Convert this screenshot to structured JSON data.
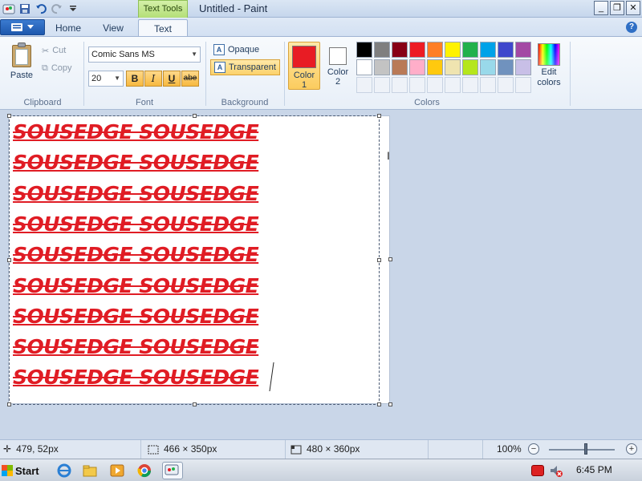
{
  "window": {
    "title": "Untitled - Paint",
    "context_tab": "Text Tools",
    "controls": {
      "minimize": "_",
      "restore": "❐",
      "close": "✕"
    }
  },
  "tabs": [
    {
      "label": "Home"
    },
    {
      "label": "View"
    },
    {
      "label": "Text",
      "active": true
    }
  ],
  "ribbon": {
    "clipboard": {
      "paste": "Paste",
      "cut": "Cut",
      "copy": "Copy",
      "group_label": "Clipboard"
    },
    "font": {
      "family": "Comic Sans MS",
      "size": "20",
      "bold": "B",
      "italic": "I",
      "underline": "U",
      "strikethrough": "abe",
      "group_label": "Font"
    },
    "background": {
      "opaque": "Opaque",
      "transparent": "Transparent",
      "group_label": "Background"
    },
    "colors": {
      "color1_label_a": "Color",
      "color1_label_b": "1",
      "color2_label_a": "Color",
      "color2_label_b": "2",
      "color1": "#e81c24",
      "color2": "#ffffff",
      "edit_a": "Edit",
      "edit_b": "colors",
      "group_label": "Colors",
      "palette_row1": [
        "#000000",
        "#7f7f7f",
        "#880015",
        "#ed1c24",
        "#ff7f27",
        "#fff200",
        "#22b14c",
        "#00a2e8",
        "#3f48cc",
        "#a349a4"
      ],
      "palette_row2": [
        "#ffffff",
        "#c3c3c3",
        "#b97a57",
        "#ffaec9",
        "#ffc90e",
        "#efe4b0",
        "#b5e61d",
        "#99d9ea",
        "#7092be",
        "#c8bfe7"
      ]
    }
  },
  "canvas": {
    "text_lines": [
      "SOUSEDGE SOUSEDGE",
      "SOUSEDGE SOUSEDGE",
      "SOUSEDGE SOUSEDGE",
      "SOUSEDGE SOUSEDGE",
      "SOUSEDGE SOUSEDGE",
      "SOUSEDGE SOUSEDGE",
      "SOUSEDGE SOUSEDGE",
      "SOUSEDGE SOUSEDGE",
      "SOUSEDGE SOUSEDGE"
    ]
  },
  "status": {
    "cursor_pos": "479, 52px",
    "selection_size": "466 × 350px",
    "image_size": "480 × 360px",
    "zoom": "100%"
  },
  "taskbar": {
    "start": "Start",
    "clock": "6:45 PM"
  }
}
